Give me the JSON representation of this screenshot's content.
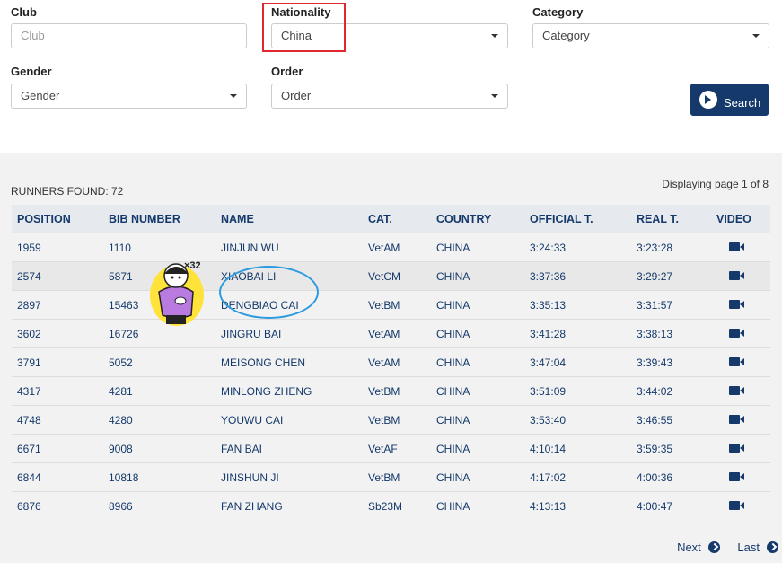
{
  "filters": {
    "club": {
      "label": "Club",
      "placeholder": "Club"
    },
    "nationality": {
      "label": "Nationality",
      "value": "China"
    },
    "category": {
      "label": "Category",
      "value": "Category"
    },
    "gender": {
      "label": "Gender",
      "value": "Gender"
    },
    "order": {
      "label": "Order",
      "value": "Order"
    },
    "search_label": "Search"
  },
  "results": {
    "found": "RUNNERS FOUND: 72",
    "paging": "Displaying page 1 of 8",
    "columns": [
      "POSITION",
      "BIB NUMBER",
      "NAME",
      "CAT.",
      "COUNTRY",
      "OFFICIAL T.",
      "REAL T.",
      "VIDEO"
    ],
    "rows": [
      [
        "1959",
        "1110",
        "JINJUN WU",
        "VetAM",
        "CHINA",
        "3:24:33",
        "3:23:28"
      ],
      [
        "2574",
        "5871",
        "XIAOBAI LI",
        "VetCM",
        "CHINA",
        "3:37:36",
        "3:29:27"
      ],
      [
        "2897",
        "15463",
        "DENGBIAO CAI",
        "VetBM",
        "CHINA",
        "3:35:13",
        "3:31:57"
      ],
      [
        "3602",
        "16726",
        "JINGRU BAI",
        "VetAM",
        "CHINA",
        "3:41:28",
        "3:38:13"
      ],
      [
        "3791",
        "5052",
        "MEISONG CHEN",
        "VetAM",
        "CHINA",
        "3:47:04",
        "3:39:43"
      ],
      [
        "4317",
        "4281",
        "MINLONG ZHENG",
        "VetBM",
        "CHINA",
        "3:51:09",
        "3:44:02"
      ],
      [
        "4748",
        "4280",
        "YOUWU CAI",
        "VetBM",
        "CHINA",
        "3:53:40",
        "3:46:55"
      ],
      [
        "6671",
        "9008",
        "FAN BAI",
        "VetAF",
        "CHINA",
        "4:10:14",
        "3:59:35"
      ],
      [
        "6844",
        "10818",
        "JINSHUN JI",
        "VetBM",
        "CHINA",
        "4:17:02",
        "4:00:36"
      ],
      [
        "6876",
        "8966",
        "FAN ZHANG",
        "Sb23M",
        "CHINA",
        "4:13:13",
        "4:00:47"
      ]
    ],
    "next": "Next",
    "last": "Last"
  },
  "sticker": {
    "text": "×32"
  },
  "icons": {
    "video": "video-camera-icon",
    "search": "arrow-right-circle-icon"
  },
  "colors": {
    "brand": "#14396a",
    "highlight_box": "#e0282e",
    "annotation_circle": "#2a9be0"
  }
}
